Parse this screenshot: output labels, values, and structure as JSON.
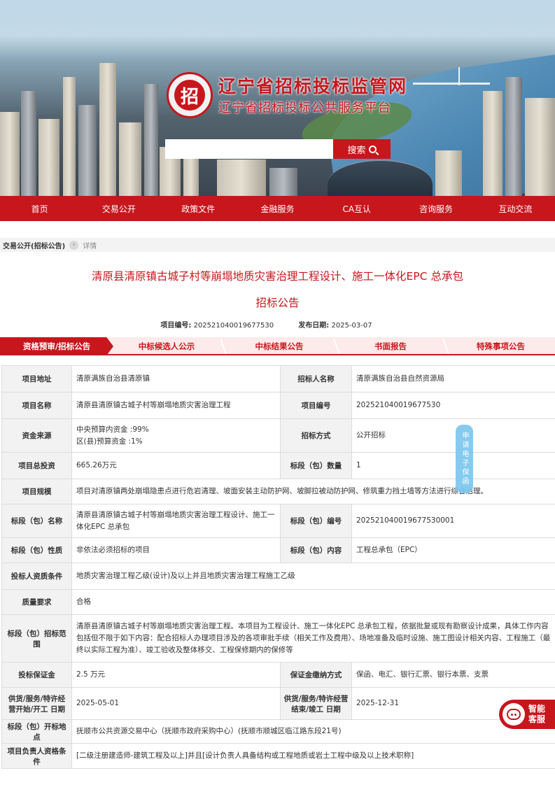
{
  "header": {
    "logo_char": "招",
    "site_title": "辽宁省招标投标监管网",
    "site_subtitle": "辽宁省招标投标公共服务平台",
    "search": {
      "placeholder": "",
      "button_label": "搜索"
    }
  },
  "nav": [
    "首页",
    "交易公开",
    "政策文件",
    "金融服务",
    "CA互认",
    "咨询服务",
    "互动交流"
  ],
  "breadcrumb": {
    "parent": "交易公开(招标公告)",
    "current": "详情"
  },
  "notice": {
    "title_line1": "清原县清原镇古城子村等崩塌地质灾害治理工程设计、施工一体化EPC 总承包",
    "title_line2": "招标公告",
    "project_no_label": "项目编号:",
    "project_no": "2025210400196775​30",
    "date_label": "发布日期:",
    "date": "2025-03-07"
  },
  "tabs": [
    "资格预审/招标公告",
    "中标候选人公示",
    "中标结果公告",
    "书面报告",
    "特殊事项公告"
  ],
  "table": {
    "r1": {
      "l1": "项目地址",
      "v1": "清原满族自治县清原镇",
      "l2": "招标人名称",
      "v2": "清原满族自治县自然资源局"
    },
    "r2": {
      "l1": "项目名称",
      "v1": "清原县清原镇古城子村等崩塌地质灾害治理工程",
      "l2": "项目编号",
      "v2": "202521040019677530"
    },
    "r3": {
      "l1": "资金来源",
      "v1a": "中央预算内资金 :99%",
      "v1b": "区(县)预算资金 :1%",
      "l2": "招标方式",
      "v2": "公开招标"
    },
    "r4": {
      "l1": "项目总投资",
      "v1": "665.26万元",
      "l2": "标段（包）数量",
      "v2": "1"
    },
    "r5": {
      "l1": "项目规模",
      "v1": "项目对清原镇两处崩塌隐患点进行危岩清理、坡面安装主动防护网、坡脚拉被动防护网、修筑重力挡土墙等方法进行综合治理。"
    },
    "r6": {
      "l1": "标段（包）名称",
      "v1": "清原县清原镇古城子村等崩塌地质灾害治理工程设计、施工一体化EPC 总承包",
      "l2": "标段（包）编号",
      "v2": "202521040019677530001"
    },
    "r7": {
      "l1": "标段（包）性质",
      "v1": "非依法必须招标的项目",
      "l2": "标段（包）内容",
      "v2": "工程总承包（EPC）"
    },
    "r8": {
      "l1": "投标人资质条件",
      "v1": "地质灾害治理工程乙级(设计)及以上并且地质灾害治理工程施工乙级"
    },
    "r9": {
      "l1": "质量要求",
      "v1": "合格"
    },
    "r10": {
      "l1": "标段（包）招标范围",
      "v1": "清原县清原镇古城子村等崩塌地质灾害治理工程。本项目为工程设计、施工一体化EPC 总承包工程，依据批复或现有勘察设计成果，具体工作内容包括但不限于如下内容：配合招标人办理项目涉及的各项审批手续（相关工作及费用）、场地准备及临时设施、施工图设计相关内容、工程施工（最终以实际工程为准）、竣工验收及整体移交、工程保修期内的保修等"
    },
    "r11": {
      "l1": "投标保证金",
      "v1": "2.5 万元",
      "l2": "保证金缴纳方式",
      "v2": "保函、电汇、银行汇票、银行本票、支票"
    },
    "r12": {
      "l1": "供货/服务/特许经营开始/开工 日期",
      "v1": "2025-05-01",
      "l2": "供货/服务/特许经营结束/竣工 日期",
      "v2": "2025-12-31"
    },
    "r13": {
      "l1": "标段（包）开标地点",
      "v1": "抚顺市公共资源交易中心（抚顺市政府采购中心）(抚顺市顺城区临江路东段21号)"
    },
    "r14": {
      "l1": "项目负责人资格条件",
      "v1": "[二级注册建造师-建筑工程及以上]并且[设计负责人具备结构或工程地质或岩土工程中级及以上技术职称]"
    }
  },
  "floating": {
    "apply_label": "申请电子保函",
    "chat_label": "智能客服"
  },
  "colors": {
    "brand_red": "#c8161d",
    "tab_bg": "#fdeaea",
    "label_bg": "#f2f2f2",
    "apply_blue": "#7cc7ee"
  }
}
